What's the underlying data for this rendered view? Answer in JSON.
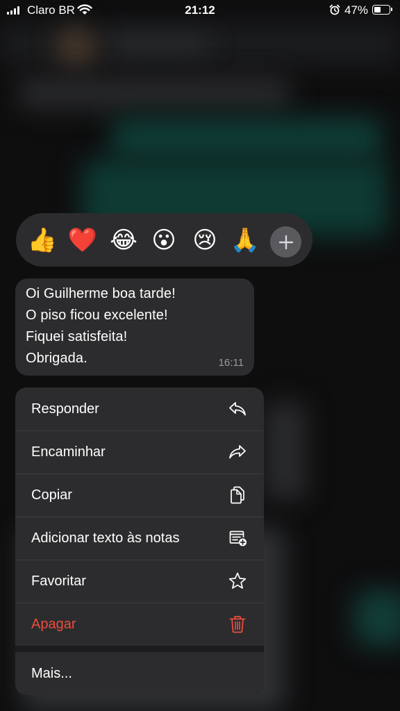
{
  "status_bar": {
    "carrier": "Claro BR",
    "time": "21:12",
    "battery_percent": "47%",
    "battery_level": 0.47,
    "icons": [
      "signal-icon",
      "wifi-icon",
      "alarm-icon",
      "battery-icon"
    ]
  },
  "reactions": {
    "emojis": [
      "👍",
      "❤️",
      "😂",
      "😮",
      "😢",
      "🙏"
    ],
    "more_icon": "plus-icon"
  },
  "message": {
    "lines": [
      "Oi Guilherme boa tarde!",
      "O piso ficou excelente!",
      "Fiquei satisfeita!",
      "Obrigada."
    ],
    "time": "16:11"
  },
  "menu": {
    "items": [
      {
        "label": "Responder",
        "icon": "reply-icon"
      },
      {
        "label": "Encaminhar",
        "icon": "forward-icon"
      },
      {
        "label": "Copiar",
        "icon": "copy-icon"
      },
      {
        "label": "Adicionar texto às notas",
        "icon": "add-note-icon"
      },
      {
        "label": "Favoritar",
        "icon": "star-icon"
      },
      {
        "label": "Apagar",
        "icon": "trash-icon",
        "color": "#eb4d3d"
      }
    ],
    "more_label": "Mais..."
  }
}
